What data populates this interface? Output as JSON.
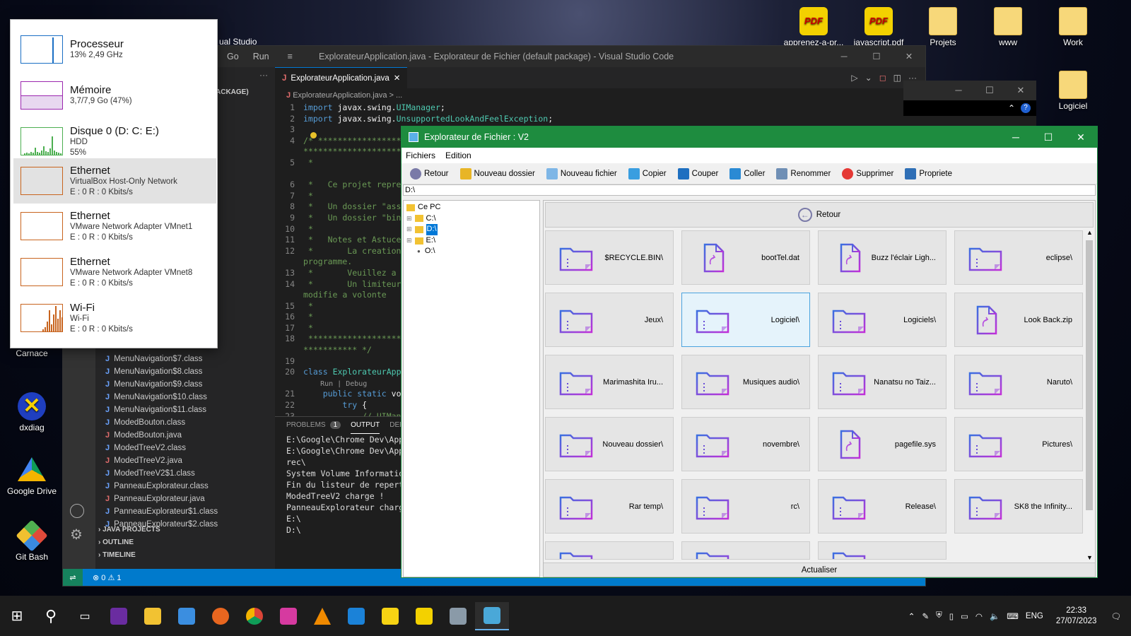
{
  "desktop": {
    "icons": [
      {
        "label": "apprenez-a-pr...",
        "icon": "pdf-icon"
      },
      {
        "label": "javascript.pdf",
        "icon": "pdf-icon"
      },
      {
        "label": "Projets",
        "icon": "folder-icon"
      },
      {
        "label": "www",
        "icon": "folder-icon"
      },
      {
        "label": "Work",
        "icon": "folder-icon"
      },
      {
        "label": "Logiciel",
        "icon": "folder-icon"
      },
      {
        "label": "Carnace",
        "icon": "app-icon"
      },
      {
        "label": "dxdiag",
        "icon": "dxdiag-icon"
      },
      {
        "label": "Google Drive",
        "icon": "google-drive-icon"
      },
      {
        "label": "Git Bash",
        "icon": "git-bash-icon"
      }
    ],
    "vs_label": "ual Studio"
  },
  "vscode": {
    "menu": [
      "Go",
      "Run"
    ],
    "window_title": "ExplorateurApplication.java - Explorateur de Fichier (default package) - Visual Studio Code",
    "package_label": "ACKAGE)",
    "tab": "ExplorateurApplication.java",
    "breadcrumb": "ExplorateurApplication.java > ...",
    "files": [
      {
        "name": "MenuNavigation$7.class",
        "type": "class"
      },
      {
        "name": "MenuNavigation$8.class",
        "type": "class"
      },
      {
        "name": "MenuNavigation$9.class",
        "type": "class"
      },
      {
        "name": "MenuNavigation$10.class",
        "type": "class"
      },
      {
        "name": "MenuNavigation$11.class",
        "type": "class"
      },
      {
        "name": "ModedBouton.class",
        "type": "class"
      },
      {
        "name": "ModedBouton.java",
        "type": "java"
      },
      {
        "name": "ModedTreeV2.class",
        "type": "class"
      },
      {
        "name": "ModedTreeV2.java",
        "type": "java"
      },
      {
        "name": "ModedTreeV2$1.class",
        "type": "class"
      },
      {
        "name": "PanneauExplorateur.class",
        "type": "class"
      },
      {
        "name": "PanneauExplorateur.java",
        "type": "java"
      },
      {
        "name": "PanneauExplorateur$1.class",
        "type": "class"
      },
      {
        "name": "PanneauExplorateur$2.class",
        "type": "class"
      }
    ],
    "sections": [
      "JAVA PROJECTS",
      "OUTLINE",
      "TIMELINE"
    ],
    "code_lines": [
      {
        "n": "1",
        "t": "import javax.swing.UIManager;"
      },
      {
        "n": "2",
        "t": "import javax.swing.UnsupportedLookAndFeelException;"
      },
      {
        "n": "3",
        "t": ""
      },
      {
        "n": "4",
        "t": "/* **************************************"
      },
      {
        "n": "",
        "t": "**************************************"
      },
      {
        "n": "5",
        "t": " *"
      },
      {
        "n": "",
        "t": ""
      },
      {
        "n": "6",
        "t": " *   Ce projet repres"
      },
      {
        "n": "7",
        "t": " *"
      },
      {
        "n": "8",
        "t": " *   Un dossier \"asse"
      },
      {
        "n": "9",
        "t": " *   Un dossier \"bin\""
      },
      {
        "n": "10",
        "t": " *"
      },
      {
        "n": "11",
        "t": " *   Notes et Astuce"
      },
      {
        "n": "12",
        "t": " *       La creation c"
      },
      {
        "n": "",
        "t": "programme."
      },
      {
        "n": "13",
        "t": " *       Veuillez a su"
      },
      {
        "n": "14",
        "t": " *       Un limiteur e"
      },
      {
        "n": "",
        "t": "modifie a volonte"
      },
      {
        "n": "15",
        "t": " *"
      },
      {
        "n": "16",
        "t": " *"
      },
      {
        "n": "17",
        "t": " *"
      },
      {
        "n": "18",
        "t": " **************************************"
      },
      {
        "n": "",
        "t": "*********** */"
      },
      {
        "n": "19",
        "t": ""
      },
      {
        "n": "20",
        "t": "class ExplorateurAppl"
      },
      {
        "n": "",
        "t": "    Run | Debug"
      },
      {
        "n": "21",
        "t": "    public static voi"
      },
      {
        "n": "22",
        "t": "        try {"
      },
      {
        "n": "23",
        "t": "            // UIMana"
      }
    ],
    "panel_tabs": [
      "PROBLEMS",
      "OUTPUT",
      "DEBUG"
    ],
    "problems_count": "1",
    "output_lines": [
      "E:\\Google\\Chrome Dev\\Applic",
      "E:\\Google\\Chrome Dev\\Applic",
      "rec\\",
      "System Volume Information\\",
      "",
      "Fin du listeur de repertoir",
      "",
      "ModedTreeV2 charge !",
      "PanneauExplorateur charge !",
      "E:\\",
      "D:\\"
    ],
    "status": {
      "errors": "0",
      "warnings": "1"
    }
  },
  "taskmanager": [
    {
      "title": "Processeur",
      "l1": "13%  2,49 GHz",
      "l2": "",
      "color": "#1a6fc4"
    },
    {
      "title": "Mémoire",
      "l1": "3,7/7,9 Go (47%)",
      "l2": "",
      "color": "#9b27af"
    },
    {
      "title": "Disque 0 (D: C: E:)",
      "l1": "HDD",
      "l2": "55%",
      "color": "#4caf50"
    },
    {
      "title": "Ethernet",
      "l1": "VirtualBox Host-Only Network",
      "l2": "E : 0 R : 0 Kbits/s",
      "color": "#c8641e"
    },
    {
      "title": "Ethernet",
      "l1": "VMware Network Adapter VMnet1",
      "l2": "E : 0 R : 0 Kbits/s",
      "color": "#c8641e"
    },
    {
      "title": "Ethernet",
      "l1": "VMware Network Adapter VMnet8",
      "l2": "E : 0 R : 0 Kbits/s",
      "color": "#c8641e"
    },
    {
      "title": "Wi-Fi",
      "l1": "Wi-Fi",
      "l2": "E : 0 R : 0 Kbits/s",
      "color": "#c8641e"
    }
  ],
  "app": {
    "title": "Explorateur de Fichier : V2",
    "menu": [
      "Fichiers",
      "Edition"
    ],
    "toolbar": [
      {
        "label": "Retour",
        "icon": "back-icon",
        "color": "#7a7aa8"
      },
      {
        "label": "Nouveau dossier",
        "icon": "new-folder-icon",
        "color": "#e8b526"
      },
      {
        "label": "Nouveau fichier",
        "icon": "new-file-icon",
        "color": "#7eb6e6"
      },
      {
        "label": "Copier",
        "icon": "copy-icon",
        "color": "#3a9ee0"
      },
      {
        "label": "Couper",
        "icon": "cut-icon",
        "color": "#1e6fc0"
      },
      {
        "label": "Coller",
        "icon": "paste-icon",
        "color": "#2a8ad4"
      },
      {
        "label": "Renommer",
        "icon": "rename-icon",
        "color": "#6f8fb5"
      },
      {
        "label": "Supprimer",
        "icon": "delete-icon",
        "color": "#e53935"
      },
      {
        "label": "Propriete",
        "icon": "properties-icon",
        "color": "#2f6fb6"
      }
    ],
    "path": "D:\\",
    "tree": {
      "root": "Ce PC",
      "nodes": [
        "C:\\",
        "D:\\",
        "E:\\",
        "O:\\"
      ]
    },
    "retour": "Retour",
    "items": [
      {
        "name": "$RECYCLE.BIN\\",
        "kind": "folder"
      },
      {
        "name": "bootTel.dat",
        "kind": "file"
      },
      {
        "name": "Buzz l'éclair Ligh...",
        "kind": "file"
      },
      {
        "name": "eclipse\\",
        "kind": "folder"
      },
      {
        "name": "Jeux\\",
        "kind": "folder"
      },
      {
        "name": "Logiciel\\",
        "kind": "folder"
      },
      {
        "name": "Logiciels\\",
        "kind": "folder"
      },
      {
        "name": "Look Back.zip",
        "kind": "file"
      },
      {
        "name": "Marimashita Iru...",
        "kind": "folder"
      },
      {
        "name": "Musiques audio\\",
        "kind": "folder"
      },
      {
        "name": "Nanatsu no Taiz...",
        "kind": "folder"
      },
      {
        "name": "Naruto\\",
        "kind": "folder"
      },
      {
        "name": "Nouveau dossier\\",
        "kind": "folder"
      },
      {
        "name": "novembre\\",
        "kind": "folder"
      },
      {
        "name": "pagefile.sys",
        "kind": "file"
      },
      {
        "name": "Pictures\\",
        "kind": "folder"
      },
      {
        "name": "Rar temp\\",
        "kind": "folder"
      },
      {
        "name": "rc\\",
        "kind": "folder"
      },
      {
        "name": "Release\\",
        "kind": "folder"
      },
      {
        "name": "SK8 the Infinity...",
        "kind": "folder"
      }
    ],
    "actualiser": "Actualiser"
  },
  "taskbar": {
    "lang": "ENG",
    "time": "22:33",
    "date": "27/07/2023"
  }
}
